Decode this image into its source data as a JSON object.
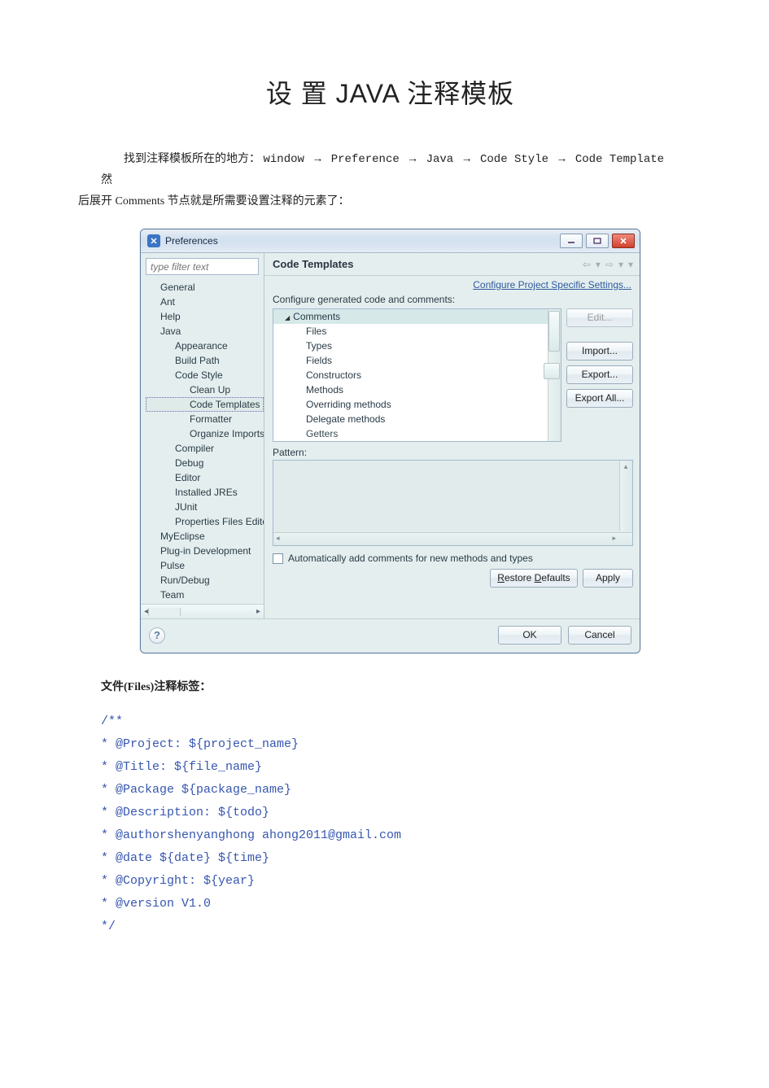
{
  "title": "设 置 JAVA  注释模板",
  "intro": {
    "prefix": "找到注释模板所在的地方：",
    "path_parts": [
      "window",
      "Preference",
      "Java",
      "Code Style",
      "Code Template"
    ],
    "suffix1": " 然",
    "suffix2": "后展开 Comments 节点就是所需要设置注释的元素了："
  },
  "window": {
    "title": "Preferences",
    "filter_placeholder": "type filter text",
    "tree": [
      {
        "label": "General",
        "indent": 1
      },
      {
        "label": "Ant",
        "indent": 1
      },
      {
        "label": "Help",
        "indent": 1
      },
      {
        "label": "Java",
        "indent": 1
      },
      {
        "label": "Appearance",
        "indent": 2
      },
      {
        "label": "Build Path",
        "indent": 2
      },
      {
        "label": "Code Style",
        "indent": 2
      },
      {
        "label": "Clean Up",
        "indent": 3
      },
      {
        "label": "Code Templates",
        "indent": 3,
        "selected": true
      },
      {
        "label": "Formatter",
        "indent": 3
      },
      {
        "label": "Organize Imports",
        "indent": 3
      },
      {
        "label": "Compiler",
        "indent": 2
      },
      {
        "label": "Debug",
        "indent": 2
      },
      {
        "label": "Editor",
        "indent": 2
      },
      {
        "label": "Installed JREs",
        "indent": 2
      },
      {
        "label": "JUnit",
        "indent": 2
      },
      {
        "label": "Properties Files Editor",
        "indent": 2
      },
      {
        "label": "MyEclipse",
        "indent": 1
      },
      {
        "label": "Plug-in Development",
        "indent": 1
      },
      {
        "label": "Pulse",
        "indent": 1
      },
      {
        "label": "Run/Debug",
        "indent": 1
      },
      {
        "label": "Team",
        "indent": 1
      }
    ],
    "content": {
      "heading": "Code Templates",
      "configure_link": "Configure Project Specific Settings...",
      "configure_label": "Configure generated code and comments:",
      "comments_root": "Comments",
      "comments_children": [
        "Files",
        "Types",
        "Fields",
        "Constructors",
        "Methods",
        "Overriding methods",
        "Delegate methods",
        "Getters"
      ],
      "buttons": {
        "edit": "Edit...",
        "import": "Import...",
        "export": "Export...",
        "export_all": "Export All..."
      },
      "pattern_label": "Pattern:",
      "auto_check": "Automatically add comments for new methods and types",
      "restore": "Restore Defaults",
      "apply": "Apply",
      "ok": "OK",
      "cancel": "Cancel"
    }
  },
  "section_heading": "文件(Files)注释标签：",
  "code_lines": [
    "/**",
    "* @Project: ${project_name}",
    "* @Title: ${file_name}",
    "* @Package ${package_name}",
    "* @Description: ${todo}",
    "* @authorshenyanghong ahong2011@gmail.com",
    "* @date ${date} ${time}",
    "* @Copyright: ${year}",
    "* @version V1.0",
    "*/"
  ]
}
